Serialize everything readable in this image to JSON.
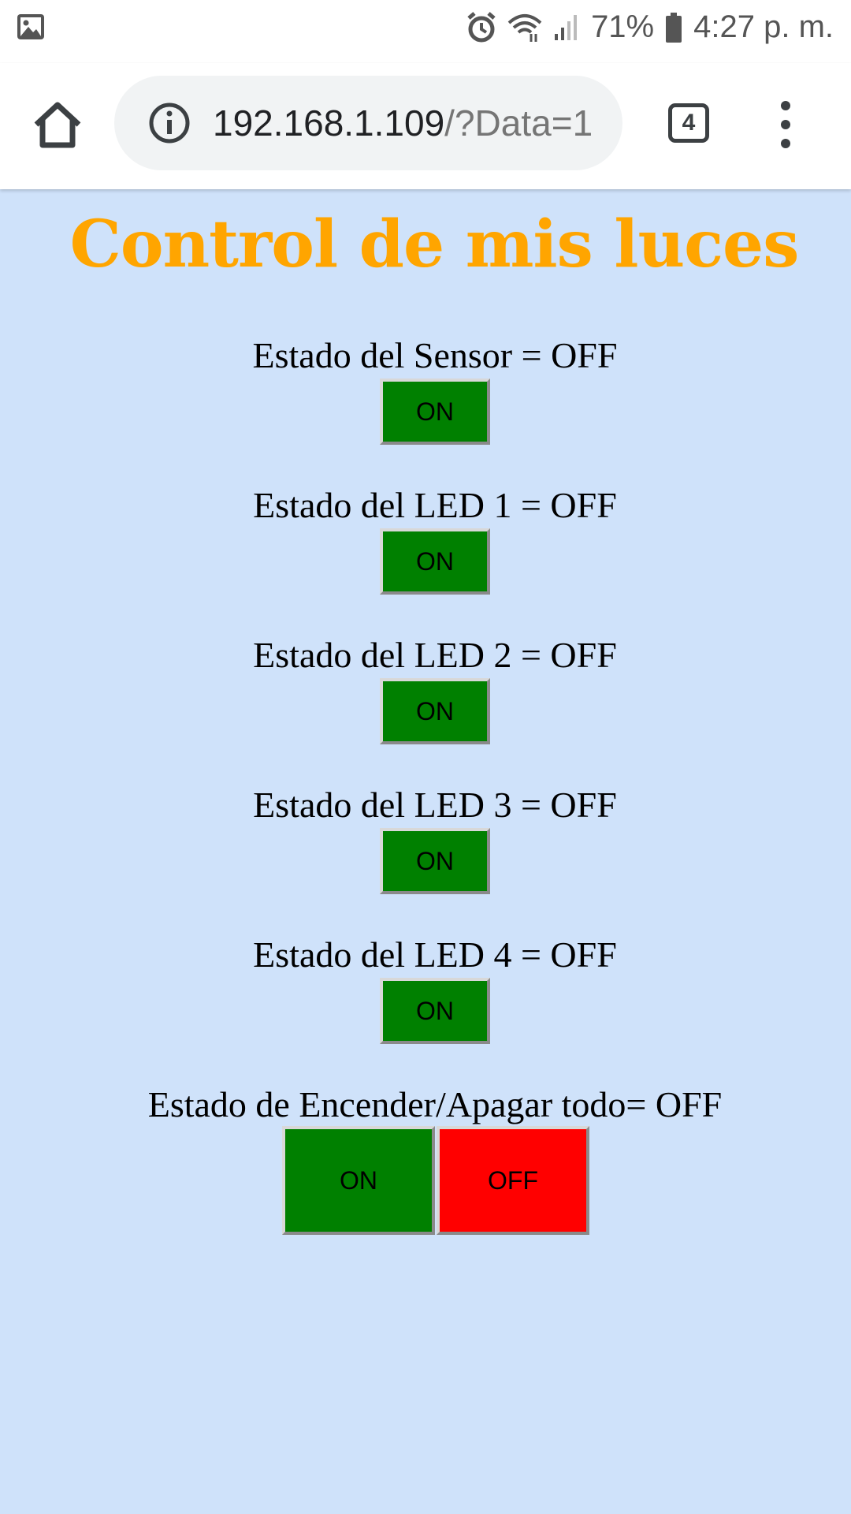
{
  "status_bar": {
    "icons": [
      "image-icon",
      "alarm-icon",
      "wifi-icon",
      "signal-icon",
      "battery-icon"
    ],
    "battery": "71%",
    "time": "4:27 p. m."
  },
  "browser": {
    "url_host": "192.168.1.109",
    "url_rest": "/?Data=1",
    "tab_count": "4",
    "icons": [
      "home-icon",
      "info-icon",
      "tabs-icon",
      "menu-icon"
    ]
  },
  "page": {
    "title": "Control de mis luces",
    "title_color": "#ffa500",
    "background": "#cfe2fa",
    "devices": [
      {
        "label": "Estado del Sensor = OFF",
        "button": "ON"
      },
      {
        "label": "Estado del LED 1 = OFF",
        "button": "ON"
      },
      {
        "label": "Estado del LED 2 = OFF",
        "button": "ON"
      },
      {
        "label": "Estado del LED 3 = OFF",
        "button": "ON"
      },
      {
        "label": "Estado del LED 4 = OFF",
        "button": "ON"
      }
    ],
    "all": {
      "label": "Estado de Encender/Apagar todo= OFF",
      "on_button": "ON",
      "off_button": "OFF"
    },
    "colors": {
      "on": "#008000",
      "off": "#ff0000"
    }
  }
}
